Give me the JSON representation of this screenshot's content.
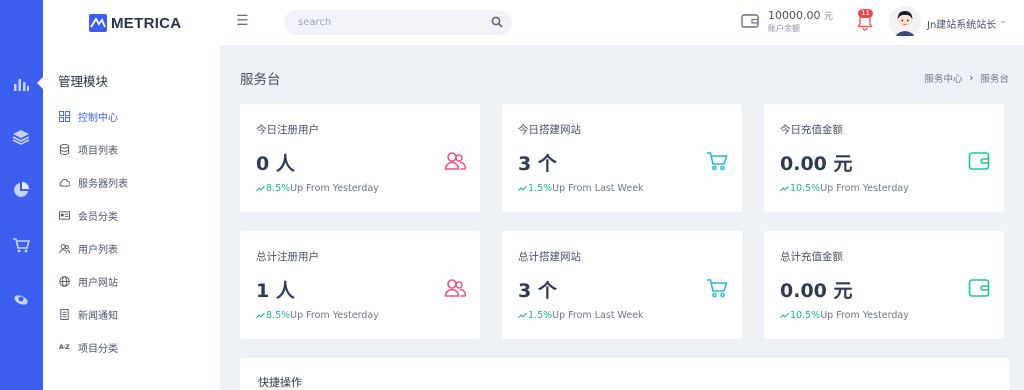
{
  "brand": {
    "name": "METRICA"
  },
  "sidebar": {
    "module_title": "管理模块",
    "items": [
      {
        "label": "控制中心",
        "icon": "dashboard-grid-icon"
      },
      {
        "label": "项目列表",
        "icon": "database-icon"
      },
      {
        "label": "服务器列表",
        "icon": "cloud-icon"
      },
      {
        "label": "会员分类",
        "icon": "id-card-icon"
      },
      {
        "label": "用户列表",
        "icon": "users-icon"
      },
      {
        "label": "用户网站",
        "icon": "globe-icon"
      },
      {
        "label": "新闻通知",
        "icon": "document-icon"
      },
      {
        "label": "项目分类",
        "icon": "az-sort-icon",
        "glyph": "A-Z"
      }
    ]
  },
  "rail": {
    "icons": [
      "bar-chart-icon",
      "layers-icon",
      "pie-chart-icon",
      "cart-icon",
      "satellite-icon"
    ]
  },
  "header": {
    "search_placeholder": "search",
    "balance_amount": "10000.00",
    "balance_unit": "元",
    "balance_label": "账户余额",
    "notification_count": "11",
    "user_name": "Jn建站系统站长",
    "caret": "⌄"
  },
  "page": {
    "title": "服务台",
    "breadcrumb": [
      "服务中心",
      "服务台"
    ],
    "breadcrumb_sep": "›"
  },
  "cards": [
    {
      "title": "今日注册用户",
      "value": "0 人",
      "trend_pct": "8.5%",
      "trend_text": "Up From Yesterday",
      "icon": "users-icon",
      "icon_color": "#f0508a"
    },
    {
      "title": "今日搭建网站",
      "value": "3 个",
      "trend_pct": "1.5%",
      "trend_text": "Up From Last Week",
      "icon": "cart-icon",
      "icon_color": "#25b7e0"
    },
    {
      "title": "今日充值金额",
      "value": "0.00 元",
      "trend_pct": "10.5%",
      "trend_text": "Up From Yesterday",
      "icon": "wallet-icon",
      "icon_color": "#1dc4a2"
    },
    {
      "title": "总计注册用户",
      "value": "1 人",
      "trend_pct": "8.5%",
      "trend_text": "Up From Yesterday",
      "icon": "users-icon",
      "icon_color": "#f0508a"
    },
    {
      "title": "总计搭建网站",
      "value": "3 个",
      "trend_pct": "1.5%",
      "trend_text": "Up From Last Week",
      "icon": "cart-icon",
      "icon_color": "#25b7e0"
    },
    {
      "title": "总计充值金额",
      "value": "0.00 元",
      "trend_pct": "10.5%",
      "trend_text": "Up From Yesterday",
      "icon": "wallet-icon",
      "icon_color": "#1dc4a2"
    }
  ],
  "quick_actions": {
    "title": "快捷操作"
  },
  "colors": {
    "accent": "#3d5ff0",
    "trend_green": "#20b49a",
    "badge_red": "#e84b4b"
  }
}
